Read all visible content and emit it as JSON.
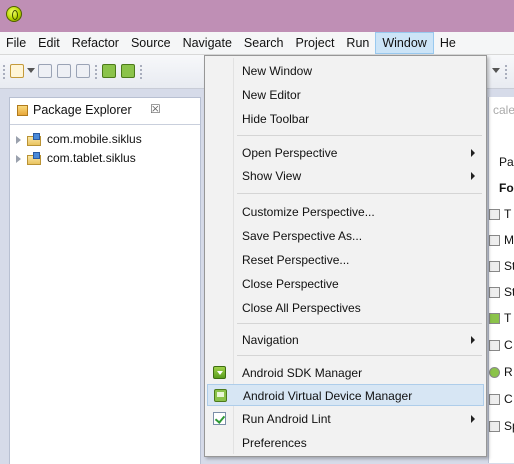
{
  "menubar": {
    "items": [
      "File",
      "Edit",
      "Refactor",
      "Source",
      "Navigate",
      "Search",
      "Project",
      "Run",
      "Window",
      "He"
    ],
    "active": "Window"
  },
  "package_explorer": {
    "title": "Package Explorer",
    "close_glyph": "☒",
    "projects": [
      "com.mobile.siklus",
      "com.tablet.siklus"
    ]
  },
  "right_view": {
    "partial_text": [
      "cale",
      "Pa",
      "Fo",
      "T",
      "M",
      "St",
      "St",
      "T",
      "C",
      "R",
      "C",
      "Sp"
    ]
  },
  "window_menu": {
    "items": [
      {
        "label": "New Window"
      },
      {
        "label": "New Editor"
      },
      {
        "label": "Hide Toolbar"
      },
      {
        "label": "Open Perspective",
        "submenu": true
      },
      {
        "label": "Show View",
        "submenu": true
      },
      {
        "label": "Customize Perspective..."
      },
      {
        "label": "Save Perspective As..."
      },
      {
        "label": "Reset Perspective..."
      },
      {
        "label": "Close Perspective"
      },
      {
        "label": "Close All Perspectives"
      },
      {
        "label": "Navigation",
        "submenu": true
      },
      {
        "label": "Android SDK Manager",
        "icon": "android-sdk-manager-icon"
      },
      {
        "label": "Android Virtual Device Manager",
        "icon": "android-avd-manager-icon",
        "highlighted": true
      },
      {
        "label": "Run Android Lint",
        "icon": "android-lint-icon",
        "submenu": true
      },
      {
        "label": "Preferences"
      }
    ]
  },
  "colors": {
    "titlebar": "#bf8fb5",
    "menu_highlight": "#d7e6f4",
    "menubar_active": "#cce4f7"
  }
}
